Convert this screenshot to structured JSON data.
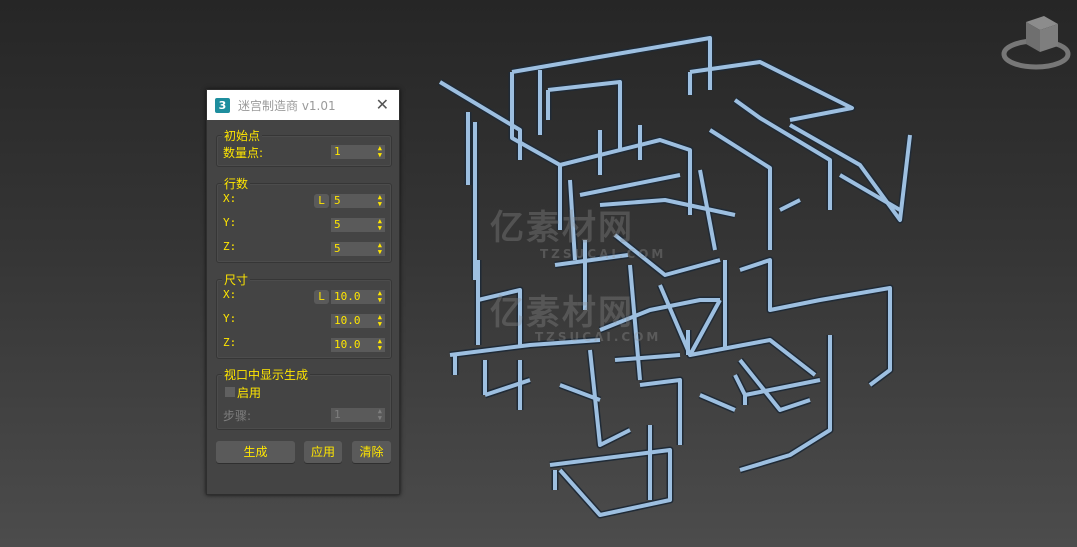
{
  "dialog": {
    "title": "迷宫制造商 v1.01",
    "app_icon": "3",
    "close": "✕",
    "groups": {
      "start": {
        "label": "初始点",
        "count_label": "数量点:",
        "count_value": "1"
      },
      "rows": {
        "label": "行数",
        "x_label": "X:",
        "y_label": "Y:",
        "z_label": "Z:",
        "lock": "L",
        "x": "5",
        "y": "5",
        "z": "5"
      },
      "size": {
        "label": "尺寸",
        "x_label": "X:",
        "y_label": "Y:",
        "z_label": "Z:",
        "lock": "L",
        "x": "10.0",
        "y": "10.0",
        "z": "10.0"
      },
      "viewport": {
        "label": "视口中显示生成",
        "enable_label": "启用",
        "enabled": false,
        "step_label": "步骤:",
        "step_value": "1"
      }
    },
    "buttons": {
      "generate": "生成",
      "apply": "应用",
      "clear": "清除"
    }
  },
  "watermark": {
    "text": "亿素材网",
    "url": "TZSUCAI.COM"
  },
  "colors": {
    "accent": "#ffe600",
    "maze": "#9dbfe0"
  }
}
